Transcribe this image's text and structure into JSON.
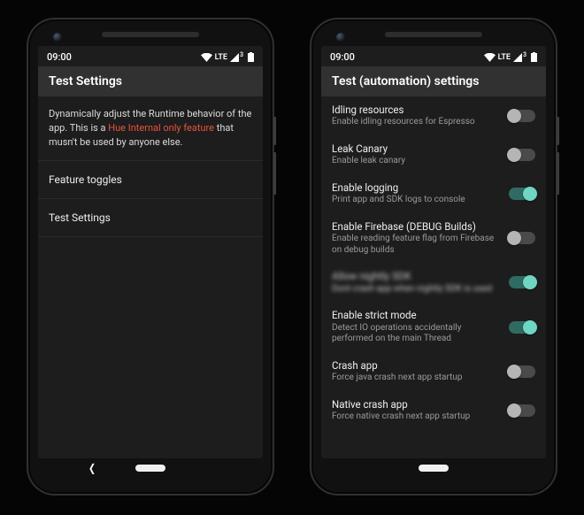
{
  "status": {
    "time": "09:00",
    "lte": "LTE",
    "lte_sup": "3"
  },
  "left": {
    "title": "Test Settings",
    "desc_pre": "Dynamically adjust the Runtime behavior of the app. This is a ",
    "desc_mid": "Hue Internal only feature",
    "desc_post": " that musn't be used by anyone else.",
    "items": [
      {
        "label": "Feature toggles"
      },
      {
        "label": "Test Settings"
      }
    ]
  },
  "right": {
    "title": "Test (automation) settings",
    "settings": [
      {
        "title": "Idling resources",
        "sub": "Enable idling resources for Espresso",
        "on": false,
        "blurred": false
      },
      {
        "title": "Leak Canary",
        "sub": "Enable leak canary",
        "on": false,
        "blurred": false
      },
      {
        "title": "Enable logging",
        "sub": "Print app and SDK logs to console",
        "on": true,
        "blurred": false
      },
      {
        "title": "Enable Firebase (DEBUG Builds)",
        "sub": "Enable reading feature flag from Firebase on debug builds",
        "on": false,
        "blurred": false
      },
      {
        "title": "Allow nightly SDK",
        "sub": "Dont crash app when nightly SDK is used",
        "on": true,
        "blurred": true
      },
      {
        "title": "Enable strict mode",
        "sub": "Detect IO operations accidentally performed on the main Thread",
        "on": true,
        "blurred": false
      },
      {
        "title": "Crash app",
        "sub": "Force java crash next app startup",
        "on": false,
        "blurred": false
      },
      {
        "title": "Native crash app",
        "sub": "Force native crash next app startup",
        "on": false,
        "blurred": false
      }
    ]
  }
}
